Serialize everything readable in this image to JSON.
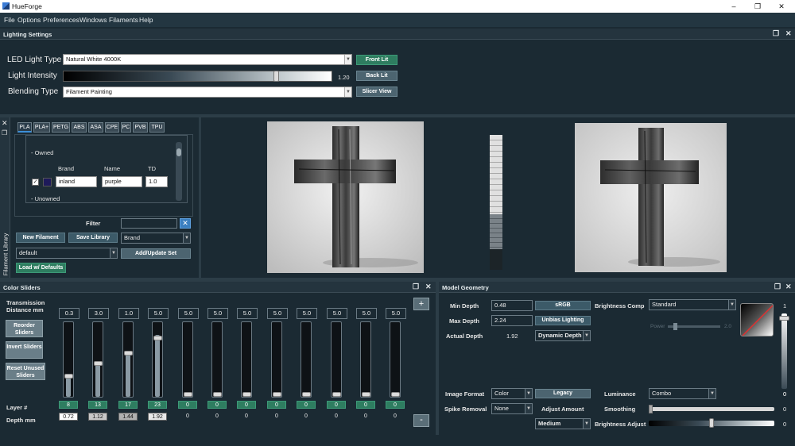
{
  "window": {
    "title": "HueForge",
    "min": "–",
    "max": "❐",
    "close": "✕"
  },
  "menu": [
    "File",
    "Options",
    "Preferences",
    "Windows",
    "Filaments",
    "Help"
  ],
  "lighting": {
    "header": "Lighting Settings",
    "led_label": "LED Light Type",
    "led_value": "Natural White 4000K",
    "intensity_label": "Light Intensity",
    "intensity_value": "1.20",
    "intensity_fraction": 0.8,
    "blending_label": "Blending Type",
    "blending_value": "Filament Painting",
    "front_lit": "Front Lit",
    "back_lit": "Back Lit",
    "slicer_view": "Slicer View"
  },
  "library": {
    "side_label": "Filament Library",
    "tabs": [
      "PLA",
      "PLA+",
      "PETG",
      "ABS",
      "ASA",
      "CPE",
      "PC",
      "PVB",
      "TPU"
    ],
    "owned": "- Owned",
    "unowned": "- Unowned",
    "col_brand": "Brand",
    "col_name": "Name",
    "col_td": "TD",
    "row": {
      "brand": "inland",
      "name": "purple",
      "td": "1.0",
      "swatch": "#1e1a5a"
    },
    "filter_label": "Filter",
    "new_filament": "New Filament",
    "save_library": "Save Library",
    "sort_value": "Brand",
    "set_value": "default",
    "add_update": "Add/Update Set",
    "load_defaults": "Load w/ Defaults"
  },
  "color_sliders": {
    "header": "Color Sliders",
    "trans_label": "Transmission Distance mm",
    "reorder": "Reorder Sliders",
    "invert": "Invert Sliders",
    "reset": "Reset Unused Sliders",
    "layer_label": "Layer #",
    "depth_label": "Depth mm",
    "plus": "+",
    "minus": "-",
    "sliders": [
      {
        "td": "0.3",
        "layer": "8",
        "depth": "0.72",
        "level": 0.27,
        "boxed": true,
        "shade": "#ffffff"
      },
      {
        "td": "3.0",
        "layer": "13",
        "depth": "1.12",
        "level": 0.45,
        "boxed": true,
        "shade": "#c8c8c8"
      },
      {
        "td": "1.0",
        "layer": "17",
        "depth": "1.44",
        "level": 0.6,
        "boxed": true,
        "shade": "#b0b0b0"
      },
      {
        "td": "5.0",
        "layer": "23",
        "depth": "1.92",
        "level": 0.83,
        "boxed": true,
        "shade": "#e8e8e8"
      },
      {
        "td": "5.0",
        "layer": "0",
        "depth": "0",
        "level": 0.0,
        "boxed": false,
        "shade": ""
      },
      {
        "td": "5.0",
        "layer": "0",
        "depth": "0",
        "level": 0.0,
        "boxed": false,
        "shade": ""
      },
      {
        "td": "5.0",
        "layer": "0",
        "depth": "0",
        "level": 0.0,
        "boxed": false,
        "shade": ""
      },
      {
        "td": "5.0",
        "layer": "0",
        "depth": "0",
        "level": 0.0,
        "boxed": false,
        "shade": ""
      },
      {
        "td": "5.0",
        "layer": "0",
        "depth": "0",
        "level": 0.0,
        "boxed": false,
        "shade": ""
      },
      {
        "td": "5.0",
        "layer": "0",
        "depth": "0",
        "level": 0.0,
        "boxed": false,
        "shade": ""
      },
      {
        "td": "5.0",
        "layer": "0",
        "depth": "0",
        "level": 0.0,
        "boxed": false,
        "shade": ""
      },
      {
        "td": "5.0",
        "layer": "0",
        "depth": "0",
        "level": 0.0,
        "boxed": false,
        "shade": ""
      }
    ]
  },
  "geometry": {
    "header": "Model Geometry",
    "min_depth_label": "Min Depth",
    "min_depth": "0.48",
    "max_depth_label": "Max Depth",
    "max_depth": "2.24",
    "actual_depth_label": "Actual Depth",
    "actual_depth": "1.92",
    "srgb": "sRGB",
    "unbias": "Unbias Lighting",
    "dynamic_depth": "Dynamic Depth",
    "brightness_comp_label": "Brightness Comp",
    "brightness_comp": "Standard",
    "power_label": "Power",
    "power_value": "2.0",
    "image_format_label": "Image Format",
    "image_format": "Color",
    "legacy": "Legacy",
    "luminance_label": "Luminance",
    "luminance": "Combo",
    "spike_label": "Spike Removal",
    "spike": "None",
    "adjust_amount_label": "Adjust Amount",
    "adjust_amount": "Medium",
    "smoothing_label": "Smoothing",
    "smoothing_value": "0",
    "brightness_adjust_label": "Brightness Adjust",
    "brightness_adjust_value": "0",
    "vert_top": "1",
    "vert_bottom": "0",
    "luminance_value": "0"
  }
}
